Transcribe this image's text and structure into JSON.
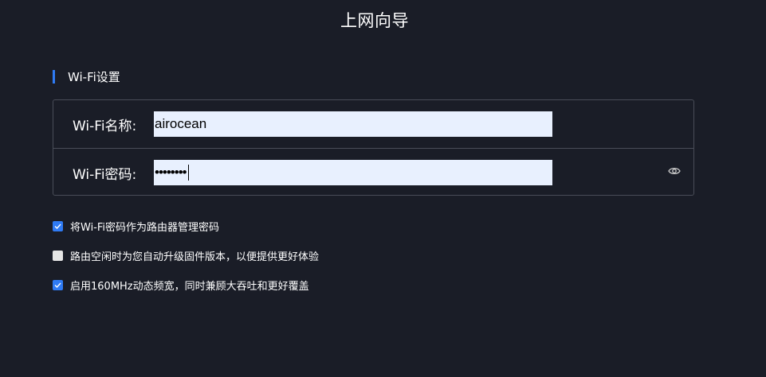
{
  "page": {
    "title": "上网向导"
  },
  "section": {
    "title": "Wi-Fi设置"
  },
  "form": {
    "ssid_label": "Wi-Fi名称:",
    "ssid_value": "airocean",
    "password_label": "Wi-Fi密码:",
    "password_display": "••••••••",
    "password_toggle_icon": "eye-icon"
  },
  "options": [
    {
      "label": "将Wi-Fi密码作为路由器管理密码",
      "checked": true
    },
    {
      "label": "路由空闲时为您自动升级固件版本，以便提供更好体验",
      "checked": false
    },
    {
      "label": "启用160MHz动态频宽，同时兼顾大吞吐和更好覆盖",
      "checked": true
    }
  ],
  "colors": {
    "background": "#1a1d27",
    "accent": "#2f7bf5",
    "border": "#494d58",
    "input_bg": "#e8f0fe"
  }
}
